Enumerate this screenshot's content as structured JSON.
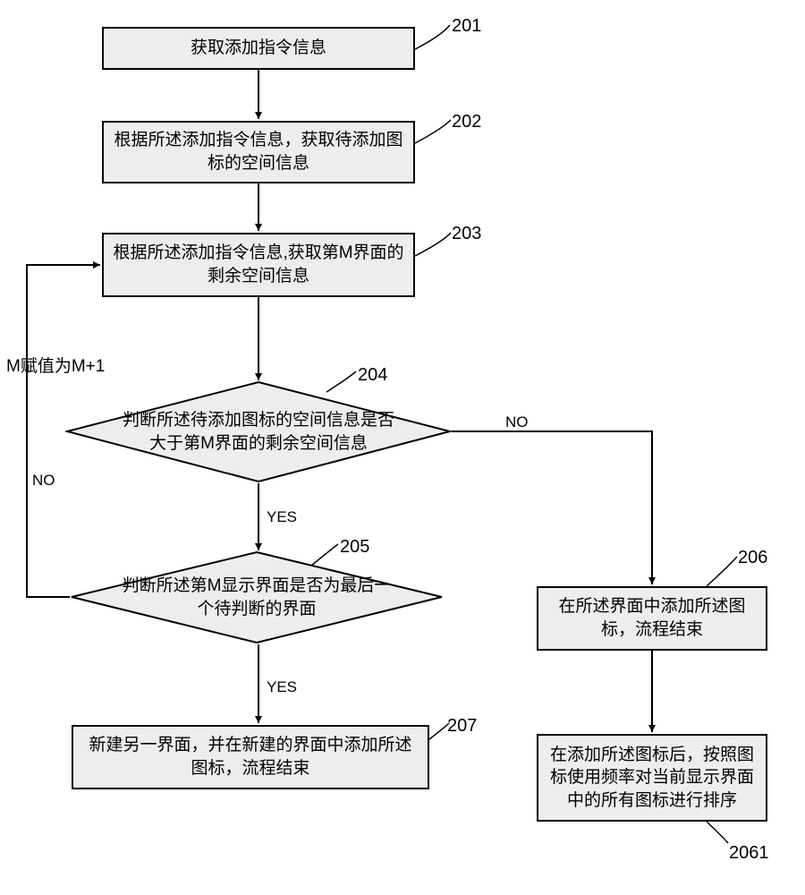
{
  "flow": {
    "type": "flowchart",
    "nodes": {
      "n201": {
        "id": "201",
        "text": "获取添加指令信息"
      },
      "n202": {
        "id": "202",
        "text": "根据所述添加指令信息，获取待添加图标的空间信息"
      },
      "n203": {
        "id": "203",
        "text": "根据所述添加指令信息,获取第M界面的剩余空间信息"
      },
      "n204": {
        "id": "204",
        "text": "判断所述待添加图标的空间信息是否大于第M界面的剩余空间信息"
      },
      "n205": {
        "id": "205",
        "text": "判断所述第M显示界面是否为最后一个待判断的界面"
      },
      "n206": {
        "id": "206",
        "text": "在所述界面中添加所述图标，流程结束"
      },
      "n2061": {
        "id": "2061",
        "text": "在添加所述图标后，按照图标使用频率对当前显示界面中的所有图标进行排序"
      },
      "n207": {
        "id": "207",
        "text": "新建另一界面，并在新建的界面中添加所述图标，流程结束"
      }
    },
    "edge_labels": {
      "yes1": "YES",
      "yes2": "YES",
      "no1": "NO",
      "no2": "NO"
    },
    "loop_label": "M赋值为M+1",
    "edges": [
      {
        "from": "201",
        "to": "202"
      },
      {
        "from": "202",
        "to": "203"
      },
      {
        "from": "203",
        "to": "204"
      },
      {
        "from": "204",
        "to": "205",
        "label": "YES"
      },
      {
        "from": "204",
        "to": "206",
        "label": "NO"
      },
      {
        "from": "205",
        "to": "207",
        "label": "YES"
      },
      {
        "from": "205",
        "to": "203",
        "label": "NO (M赋值为M+1)"
      },
      {
        "from": "206",
        "to": "2061"
      }
    ]
  }
}
